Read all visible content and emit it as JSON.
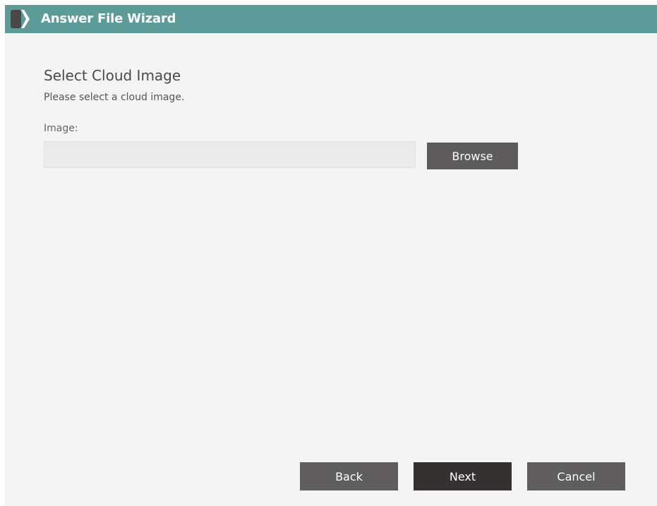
{
  "window": {
    "title": "Answer File Wizard",
    "logo_icon": "chevron-logo-icon"
  },
  "page": {
    "title": "Select Cloud Image",
    "subtitle": "Please select a cloud image."
  },
  "image_field": {
    "label": "Image:",
    "value": "",
    "placeholder": ""
  },
  "buttons": {
    "browse": "Browse",
    "back": "Back",
    "next": "Next",
    "cancel": "Cancel"
  },
  "colors": {
    "titlebar": "#5c9b98",
    "background": "#f4f4f4",
    "button": "#5f5d5d",
    "primary_button": "#353131"
  }
}
